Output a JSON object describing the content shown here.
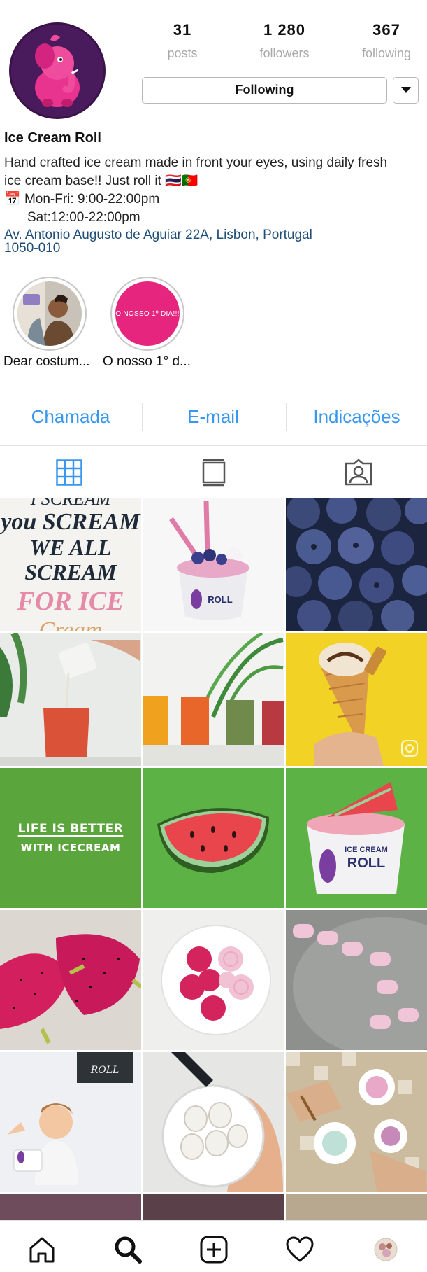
{
  "stats": {
    "posts": {
      "value": "31",
      "label": "posts"
    },
    "followers": {
      "value": "1 280",
      "label": "followers"
    },
    "following": {
      "value": "367",
      "label": "following"
    }
  },
  "actions": {
    "following_label": "Following"
  },
  "profile": {
    "name": "Ice Cream Roll",
    "bio_line1": "Hand crafted ice cream made in front your eyes, using daily fresh",
    "bio_line2": "ice cream base!! Just roll it 🇹🇭🇵🇹",
    "hours_emoji": "📅",
    "hours_weekday": "Mon-Fri: 9:00-22:00pm",
    "hours_saturday": "Sat:12:00-22:00pm",
    "address_line1": "Av. Antonio Augusto de Aguiar 22A, Lisbon, Portugal",
    "address_line2": "1050-010"
  },
  "highlights": [
    {
      "label": "Dear costum...",
      "cover_text": ""
    },
    {
      "label": "O nosso 1° d...",
      "cover_text": "O NOSSO 1º DIA!!!"
    }
  ],
  "contact": {
    "call": "Chamada",
    "email": "E-mail",
    "directions": "Indicações"
  },
  "grid_texts": {
    "scream_lines": [
      "I SCREAM",
      "you SCREAM",
      "WE ALL",
      "SCREAM",
      "FOR ICE",
      "Cream"
    ],
    "life_line1": "LIFE IS BETTER",
    "life_line2": "WITH ICECREAM",
    "brand_top": "ICE CREAM",
    "brand_roll": "ROLL"
  },
  "colors": {
    "accent": "#3897f0",
    "link": "#1f4e79",
    "green_post": "#5aa53c",
    "yellow_post": "#f2d325",
    "pink": "#e6257f"
  }
}
